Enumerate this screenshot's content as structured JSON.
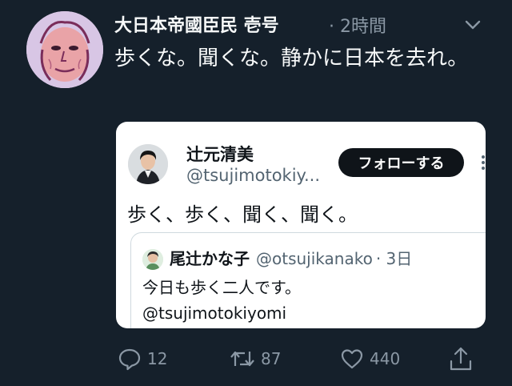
{
  "tweet": {
    "author_name": "大日本帝國臣民 壱号",
    "time": "· 2時間",
    "text": "歩くな。聞くな。静かに日本を去れ。"
  },
  "quoted": {
    "name": "辻元清美",
    "handle": "@tsujimotokiy...",
    "follow_label": "フォローする",
    "text": "歩く、歩く、聞く、聞く。",
    "inner": {
      "name": "尾辻かな子",
      "handle": "@otsujikanako",
      "time": "· 3日",
      "text": "今日も歩く二人です。",
      "mention": "@tsujimotokiyomi"
    }
  },
  "actions": {
    "reply_count": "12",
    "retweet_count": "87",
    "like_count": "440"
  },
  "colors": {
    "background": "#15202b",
    "card": "#ffffff",
    "muted_text": "#8b98a5",
    "button": "#0f1419"
  },
  "icons": [
    "reply-icon",
    "retweet-icon",
    "like-icon",
    "share-icon",
    "caret-down-icon",
    "more-icon"
  ]
}
